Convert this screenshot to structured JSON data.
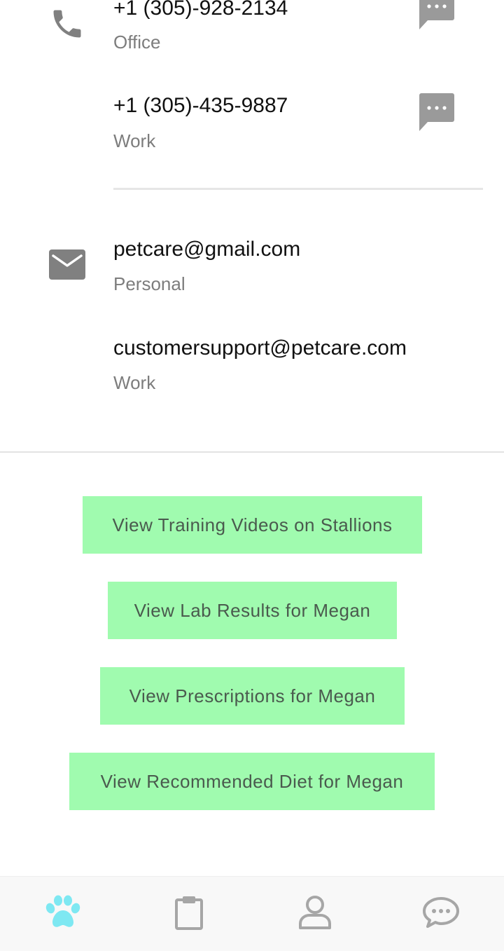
{
  "contact": {
    "phones": [
      {
        "number": "+1 (305)-928-2134",
        "label": "Office"
      },
      {
        "number": "+1 (305)-435-9887",
        "label": "Work"
      }
    ],
    "emails": [
      {
        "address": "petcare@gmail.com",
        "label": "Personal"
      },
      {
        "address": "customersupport@petcare.com",
        "label": "Work"
      }
    ]
  },
  "actions": [
    {
      "label": "View Training Videos on Stallions"
    },
    {
      "label": "View Lab Results for Megan"
    },
    {
      "label": "View Prescriptions for Megan"
    },
    {
      "label": "View Recommended Diet for Megan"
    }
  ],
  "tabbar": {
    "tabs": [
      {
        "icon": "paw-icon",
        "active": true
      },
      {
        "icon": "clipboard-icon",
        "active": false
      },
      {
        "icon": "person-icon",
        "active": false
      },
      {
        "icon": "chat-icon",
        "active": false
      }
    ]
  },
  "colors": {
    "button_bg": "#a0fbaf",
    "active_tab": "#7ee8f2",
    "inactive_tab": "#a6a6a6",
    "icon_gray": "#808080"
  }
}
